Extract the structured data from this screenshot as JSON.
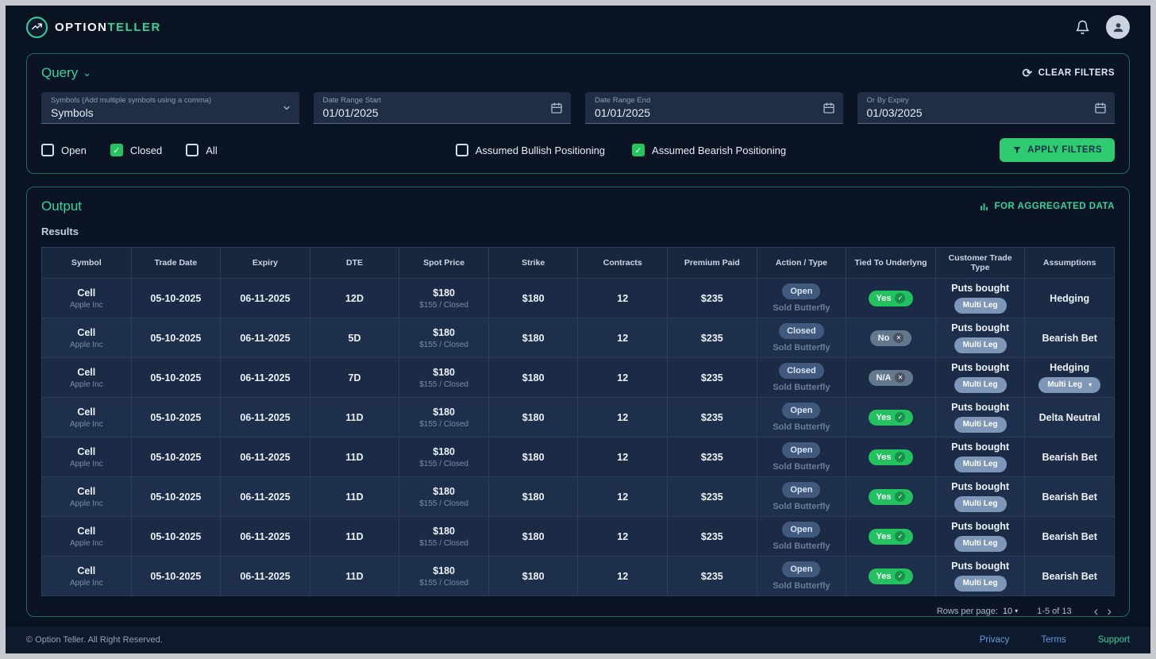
{
  "navbar": {
    "brand_primary": "OPTION",
    "brand_accent": "TELLER"
  },
  "query": {
    "title": "Query",
    "clear_filters_label": "CLEAR FILTERS",
    "fields": [
      {
        "label": "Symbols (Add multiple symbols using a comma)",
        "value": "Symbols",
        "icon": "chevron-down"
      },
      {
        "label": "Date Range Start",
        "value": "01/01/2025",
        "icon": "calendar"
      },
      {
        "label": "Date Range End",
        "value": "01/01/2025",
        "icon": "calendar"
      },
      {
        "label": "Or By Expiry",
        "value": "01/03/2025",
        "icon": "calendar"
      }
    ],
    "checkboxes": [
      {
        "label": "Open",
        "checked": false
      },
      {
        "label": "Closed",
        "checked": true
      },
      {
        "label": "All",
        "checked": false
      },
      {
        "label": "Assumed Bullish Positioning",
        "checked": false
      },
      {
        "label": "Assumed Bearish Positioning",
        "checked": true
      }
    ],
    "apply_button_label": "APPLY FILTERS"
  },
  "output": {
    "title": "Output",
    "aggregated_label": "FOR AGGREGATED DATA",
    "results_label": "Results",
    "table": {
      "columns": [
        "Symbol",
        "Trade Date",
        "Expiry",
        "DTE",
        "Spot Price",
        "Strike",
        "Contracts",
        "Premium Paid",
        "Action / Type",
        "Tied To Underlyng",
        "Customer Trade Type",
        "Assumptions"
      ],
      "rows": [
        {
          "symbol": "Cell",
          "company": "Apple Inc",
          "trade_date": "05-10-2025",
          "expiry": "06-11-2025",
          "dte": "12D",
          "spot_price": "$180",
          "spot_sub": "$155 / Closed",
          "strike": "$180",
          "contracts": "12",
          "premium": "$235",
          "action": "Open",
          "action_sub": "Sold Butterfly",
          "tied": "Yes",
          "tied_type": "yes",
          "tied_icon": "check",
          "trade_type": "Puts bought",
          "trade_type_badge": "Multi Leg",
          "assumption": "Hedging",
          "assumption_badge": null
        },
        {
          "symbol": "Cell",
          "company": "Apple Inc",
          "trade_date": "05-10-2025",
          "expiry": "06-11-2025",
          "dte": "5D",
          "spot_price": "$180",
          "spot_sub": "$155 / Closed",
          "strike": "$180",
          "contracts": "12",
          "premium": "$235",
          "action": "Closed",
          "action_sub": "Sold Butterfly",
          "tied": "No",
          "tied_type": "no",
          "tied_icon": "cross",
          "trade_type": "Puts bought",
          "trade_type_badge": "Multi Leg",
          "assumption": "Bearish Bet",
          "assumption_badge": null
        },
        {
          "symbol": "Cell",
          "company": "Apple Inc",
          "trade_date": "05-10-2025",
          "expiry": "06-11-2025",
          "dte": "7D",
          "spot_price": "$180",
          "spot_sub": "$155 / Closed",
          "strike": "$180",
          "contracts": "12",
          "premium": "$235",
          "action": "Closed",
          "action_sub": "Sold Butterfly",
          "tied": "N/A",
          "tied_type": "na",
          "tied_icon": "cross",
          "trade_type": "Puts bought",
          "trade_type_badge": "Multi Leg",
          "assumption": "Hedging",
          "assumption_badge": "Multi Leg"
        },
        {
          "symbol": "Cell",
          "company": "Apple Inc",
          "trade_date": "05-10-2025",
          "expiry": "06-11-2025",
          "dte": "11D",
          "spot_price": "$180",
          "spot_sub": "$155 / Closed",
          "strike": "$180",
          "contracts": "12",
          "premium": "$235",
          "action": "Open",
          "action_sub": "Sold Butterfly",
          "tied": "Yes",
          "tied_type": "yes",
          "tied_icon": "check",
          "trade_type": "Puts bought",
          "trade_type_badge": "Multi Leg",
          "assumption": "Delta Neutral",
          "assumption_badge": null
        },
        {
          "symbol": "Cell",
          "company": "Apple Inc",
          "trade_date": "05-10-2025",
          "expiry": "06-11-2025",
          "dte": "11D",
          "spot_price": "$180",
          "spot_sub": "$155 / Closed",
          "strike": "$180",
          "contracts": "12",
          "premium": "$235",
          "action": "Open",
          "action_sub": "Sold Butterfly",
          "tied": "Yes",
          "tied_type": "yes",
          "tied_icon": "check",
          "trade_type": "Puts bought",
          "trade_type_badge": "Multi Leg",
          "assumption": "Bearish Bet",
          "assumption_badge": null
        },
        {
          "symbol": "Cell",
          "company": "Apple Inc",
          "trade_date": "05-10-2025",
          "expiry": "06-11-2025",
          "dte": "11D",
          "spot_price": "$180",
          "spot_sub": "$155 / Closed",
          "strike": "$180",
          "contracts": "12",
          "premium": "$235",
          "action": "Open",
          "action_sub": "Sold Butterfly",
          "tied": "Yes",
          "tied_type": "yes",
          "tied_icon": "check",
          "trade_type": "Puts bought",
          "trade_type_badge": "Multi Leg",
          "assumption": "Bearish Bet",
          "assumption_badge": null
        },
        {
          "symbol": "Cell",
          "company": "Apple Inc",
          "trade_date": "05-10-2025",
          "expiry": "06-11-2025",
          "dte": "11D",
          "spot_price": "$180",
          "spot_sub": "$155 / Closed",
          "strike": "$180",
          "contracts": "12",
          "premium": "$235",
          "action": "Open",
          "action_sub": "Sold Butterfly",
          "tied": "Yes",
          "tied_type": "yes",
          "tied_icon": "check",
          "trade_type": "Puts bought",
          "trade_type_badge": "Multi Leg",
          "assumption": "Bearish Bet",
          "assumption_badge": null
        },
        {
          "symbol": "Cell",
          "company": "Apple Inc",
          "trade_date": "05-10-2025",
          "expiry": "06-11-2025",
          "dte": "11D",
          "spot_price": "$180",
          "spot_sub": "$155 / Closed",
          "strike": "$180",
          "contracts": "12",
          "premium": "$235",
          "action": "Open",
          "action_sub": "Sold Butterfly",
          "tied": "Yes",
          "tied_type": "yes",
          "tied_icon": "check",
          "trade_type": "Puts bought",
          "trade_type_badge": "Multi Leg",
          "assumption": "Bearish Bet",
          "assumption_badge": null
        }
      ]
    },
    "pagination": {
      "rows_per_page_label": "Rows per page:",
      "rows_per_page_value": "10",
      "range_label": "1-5 of 13"
    }
  },
  "footer": {
    "copyright": "© Option Teller. All Right Reserved.",
    "links": [
      {
        "label": "Privacy"
      },
      {
        "label": "Terms"
      },
      {
        "label": "Support"
      }
    ]
  }
}
